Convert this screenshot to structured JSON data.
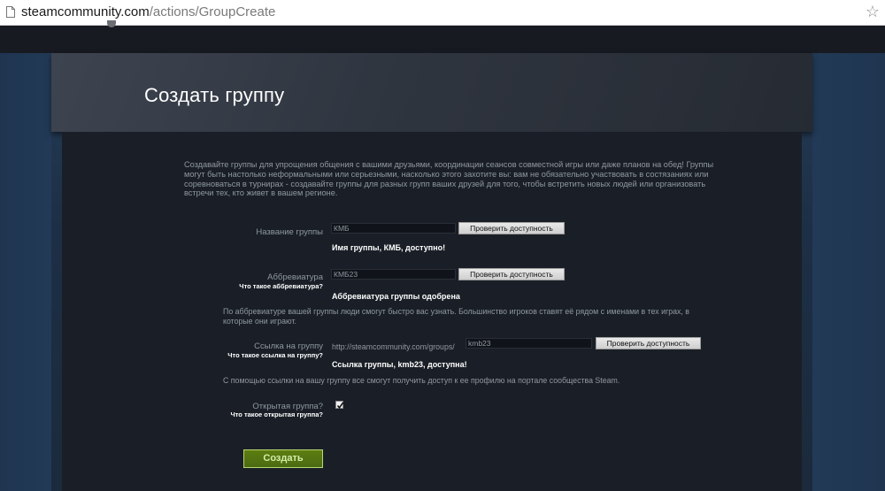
{
  "browser": {
    "url_host": "steamcommunity.com",
    "url_path": "/actions/GroupCreate",
    "bookmark_star": "☆"
  },
  "page": {
    "title": "Создать группу",
    "intro": "Создавайте группы для упрощения общения с вашими друзьями, координации сеансов совместной игры или даже планов на обед! Группы могут быть настолько неформальными или серьезными, насколько этого захотите вы: вам не обязательно участвовать в состязаниях или соревноваться в турнирах - создавайте группы для разных групп ваших друзей для того, чтобы встретить новых людей или организовать встречи тех, кто живет в вашем регионе."
  },
  "form": {
    "group_name": {
      "label": "Название группы",
      "value": "КМБ",
      "check_label": "Проверить доступность",
      "status": "Имя группы, КМБ, доступно!"
    },
    "abbreviation": {
      "label": "Аббревиатура",
      "help_link": "Что такое аббревиатура?",
      "value": "КМБ23",
      "check_label": "Проверить доступность",
      "status": "Аббревиатура группы одобрена",
      "note": "По аббревиатуре вашей группы люди смогут быстро вас узнать. Большинство игроков ставят её рядом с именами в тех играх, в которые они играют."
    },
    "group_link": {
      "label": "Ссылка на группу",
      "help_link": "Что такое ссылка на группу?",
      "prefix": "http://steamcommunity.com/groups/",
      "value": "kmb23",
      "check_label": "Проверить доступность",
      "status": "Ссылка группы, kmb23, доступна!",
      "note": "С помощью ссылки на вашу группу все смогут получить доступ к ее профилю на портале сообщества Steam."
    },
    "open_group": {
      "label": "Открытая группа?",
      "help_link": "Что такое открытая группа?",
      "checked": true
    },
    "create_label": "Создать"
  },
  "colors": {
    "background": "#1b2838",
    "panel": "#1a1f27",
    "text_muted": "#8f98a0",
    "create_button": "#5c7e10"
  }
}
